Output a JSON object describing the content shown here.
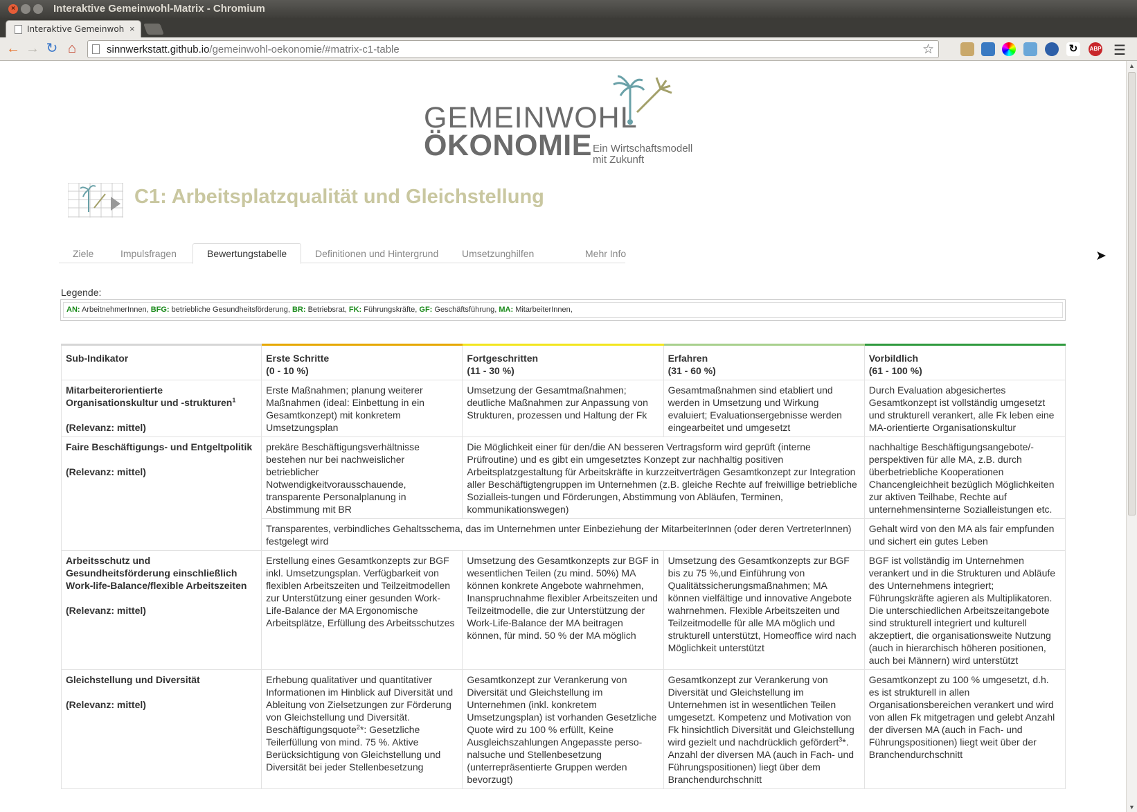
{
  "window": {
    "title": "Interaktive Gemeinwohl-Matrix - Chromium"
  },
  "tab": {
    "title": "Interaktive Gemeinwohl-M",
    "close": "×"
  },
  "address": {
    "host": "sinnwerkstatt.github.io",
    "path": "/gemeinwohl-oekonomie/#matrix-c1-table"
  },
  "logo": {
    "line1": "GEMEINWOHL",
    "line2": "ÖKONOMIE",
    "tagline1": "Ein Wirtschaftsmodell",
    "tagline2": "mit Zukunft"
  },
  "page": {
    "title": "C1: Arbeitsplatzqualität und Gleichstellung"
  },
  "nav_tabs": [
    {
      "label": "Ziele"
    },
    {
      "label": "Impulsfragen"
    },
    {
      "label": "Bewertungstabelle",
      "active": true
    },
    {
      "label": "Definitionen und Hintergrund"
    },
    {
      "label": "Umsetzunghilfen"
    },
    {
      "label": "Mehr Info"
    }
  ],
  "legend": {
    "label": "Legende:",
    "items": [
      {
        "key": "AN:",
        "text": "ArbeitnehmerInnen,"
      },
      {
        "key": "BFG:",
        "text": "betriebliche Gesundheitsförderung,"
      },
      {
        "key": "BR:",
        "text": "Betriebsrat,"
      },
      {
        "key": "FK:",
        "text": "Führungskräfte,"
      },
      {
        "key": "GF:",
        "text": "Geschäftsführung,"
      },
      {
        "key": "MA:",
        "text": "MitarbeiterInnen,"
      }
    ]
  },
  "table": {
    "headers": {
      "indicator": "Sub-Indikator",
      "lvl1_name": "Erste Schritte",
      "lvl1_range": "(0 - 10 %)",
      "lvl2_name": "Fortgeschritten",
      "lvl2_range": "(11 - 30 %)",
      "lvl3_name": "Erfahren",
      "lvl3_range": "(31 - 60 %)",
      "lvl4_name": "Vorbildlich",
      "lvl4_range": "(61 - 100 %)"
    },
    "rows": [
      {
        "indicator": "Mitarbeiterorientierte Organisationskultur und -strukturen",
        "sup": "1",
        "relevance": "(Relevanz: mittel)",
        "c1": "Erste Maßnahmen; planung weiterer Maßnahmen (ideal: Einbettung in ein Gesamtkonzept) mit konkretem Umsetzungsplan",
        "c2": "Umsetzung der Gesamtmaßnahmen; deutliche Maßnahmen zur Anpassung von Strukturen, prozessen und Haltung der Fk",
        "c3": "Gesamtmaßnahmen sind etabliert und werden in Umsetzung und Wirkung evaluiert; Evaluationsergebnisse werden eingearbeitet und umgesetzt",
        "c4": "Durch Evaluation abgesichertes Gesamtkonzept ist vollständig umgesetzt und strukturell verankert, alle Fk leben eine MA-orientierte Organisationskultur"
      },
      {
        "indicator": "Faire Beschäftigungs- und Entgeltpolitik",
        "relevance": "(Relevanz: mittel)",
        "c1": "prekäre Beschäftigungsverhältnisse bestehen nur bei nachweislicher betrieblicher Notwendigkeitvorausschauende, transparente Personalplanung in Abstimmung mit BR",
        "c23": "Die Möglichkeit einer für den/die AN besseren Vertragsform wird geprüft (interne Prüfroutine) und es gibt ein umgesetztes Konzept zur nachhaltig positiven Arbeitsplatzgestaltung für Arbeitskräfte in kurzzeitverträgen Gesamtkonzept zur Integration aller Beschäftigtengruppen im Unternehmen (z.B. gleiche Rechte auf freiwillige betriebliche Sozialleis-tungen und Förderungen, Abstimmung von Abläufen, Terminen, kommunikationswegen)",
        "c4": "nachhaltige Beschäftigungsangebote/-perspektiven für alle MA, z.B. durch überbetriebliche Kooperationen Chancengleichheit bezüglich Möglichkeiten zur aktiven Teilhabe, Rechte auf unternehmensinterne Sozialleistungen etc.",
        "sub_c123": "Transparentes, verbindliches Gehaltsschema, das im Unternehmen unter Einbeziehung der MitarbeiterInnen (oder deren VertreterInnen) festgelegt wird",
        "sub_c4": "Gehalt wird von den MA als fair empfunden und sichert ein gutes Leben"
      },
      {
        "indicator": "Arbeitsschutz und Gesundheitsförderung einschließlich Work-life-Balance/flexible Arbeitszeiten",
        "relevance": "(Relevanz: mittel)",
        "c1": "Erstellung eines Gesamtkonzepts zur BGF inkl. Umsetzungsplan. Verfügbarkeit von flexiblen Arbeitszeiten und Teilzeitmodellen zur Unterstützung einer gesunden Work-Life-Balance der MA Ergonomische Arbeitsplätze, Erfüllung des Arbeitsschutzes",
        "c2": "Umsetzung des Gesamtkonzepts zur BGF in wesentlichen Teilen (zu mind. 50%) MA können konkrete Angebote wahrnehmen, Inanspruchnahme flexibler Arbeitszeiten und Teilzeitmodelle, die zur Unterstützung der Work-Life-Balance der MA beitragen können, für mind. 50 % der MA möglich",
        "c3": "Umsetzung des Gesamtkonzepts zur BGF bis zu 75 %,und Einführung von Qualitätssicherungsmaßnahmen; MA können vielfältige und innovative Angebote wahrnehmen. Flexible Arbeitszeiten und Teilzeitmodelle für alle MA möglich und strukturell unterstützt, Homeoffice wird nach Möglichkeit unterstützt",
        "c4": "BGF ist vollständig im Unternehmen verankert und in die Strukturen und Abläufe des Unternehmens integriert; Führungskräfte agieren als Multiplikatoren. Die unterschiedlichen Arbeitszeitangebote sind strukturell integriert und kulturell akzeptiert, die organisationsweite Nutzung (auch in hierarchisch höheren positionen, auch bei Männern) wird unterstützt"
      },
      {
        "indicator": "Gleichstellung und Diversität",
        "relevance": "(Relevanz: mittel)",
        "c1_a": "Erhebung qualitativer und quantitativer Informationen im Hinblick auf Diversität und Ableitung von Zielsetzungen zur Förderung von Gleichstellung und Diversität. Beschäftigungsquote",
        "c1_sup": "2",
        "c1_b": "*: Gesetzliche Teilerfüllung von mind. 75 %. Aktive Berücksichtigung von Gleichstellung und Diversität bei jeder Stellenbesetzung",
        "c2": "Gesamtkonzept zur Verankerung von Diversität und Gleichstellung im Unternehmen (inkl. konkretem Umsetzungsplan) ist vorhanden Gesetzliche Quote wird zu 100 % erfüllt, Keine Ausgleichszahlungen Angepasste perso-nalsuche und Stellenbesetzung (unterrepräsentierte Gruppen werden bevorzugt)",
        "c3_a": "Gesamtkonzept zur Verankerung von Diversität und Gleichstellung im Unternehmen ist in wesentlichen Teilen umgesetzt. Kompetenz und Motivation von Fk hinsichtlich Diversität und Gleichstellung wird gezielt und nachdrücklich gefördert",
        "c3_sup": "3",
        "c3_b": "*. Anzahl der diversen MA (auch in Fach- und Führungspositionen) liegt über dem Branchendurchschnitt",
        "c4": "Gesamtkonzept zu 100 % umgesetzt, d.h. es ist strukturell in allen Organisationsbereichen verankert und wird von allen Fk mitgetragen und gelebt Anzahl der diversen MA (auch in Fach- und Führungspositionen) liegt weit über der Branchendurchschnitt"
      }
    ]
  }
}
